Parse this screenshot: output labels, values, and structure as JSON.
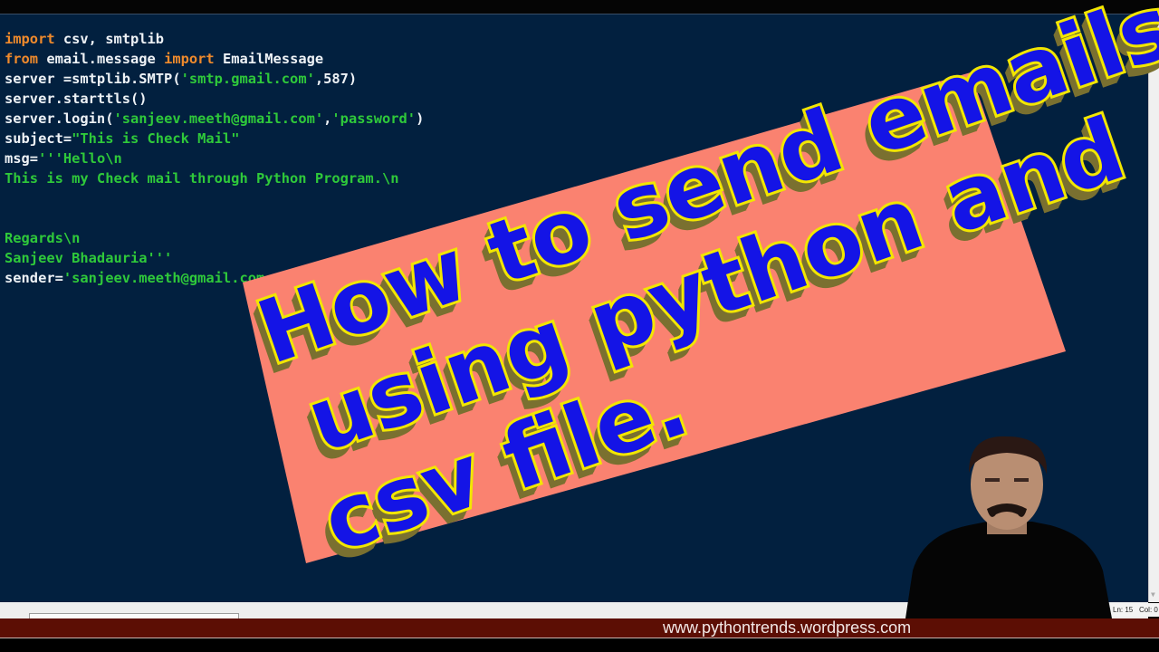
{
  "editor": {
    "code_lines": [
      [
        {
          "t": "import",
          "c": "kw"
        },
        {
          "t": " csv, smtplib",
          "c": ""
        }
      ],
      [
        {
          "t": "from",
          "c": "kw"
        },
        {
          "t": " email.message ",
          "c": ""
        },
        {
          "t": "import",
          "c": "kw"
        },
        {
          "t": " EmailMessage",
          "c": ""
        }
      ],
      [
        {
          "t": "server =smtplib.SMTP(",
          "c": ""
        },
        {
          "t": "'smtp.gmail.com'",
          "c": "str"
        },
        {
          "t": ",587)",
          "c": ""
        }
      ],
      [
        {
          "t": "server.starttls()",
          "c": ""
        }
      ],
      [
        {
          "t": "server.login(",
          "c": ""
        },
        {
          "t": "'sanjeev.meeth@gmail.com'",
          "c": "str"
        },
        {
          "t": ",",
          "c": ""
        },
        {
          "t": "'password'",
          "c": "str"
        },
        {
          "t": ")",
          "c": ""
        }
      ],
      [
        {
          "t": "subject=",
          "c": ""
        },
        {
          "t": "\"This is Check Mail\"",
          "c": "str"
        }
      ],
      [
        {
          "t": "msg=",
          "c": ""
        },
        {
          "t": "'''Hello\\n",
          "c": "str"
        }
      ],
      [
        {
          "t": "This is my Check mail through Python Program.\\n",
          "c": "str"
        }
      ],
      [],
      [],
      [
        {
          "t": "Regards\\n",
          "c": "str"
        }
      ],
      [
        {
          "t": "Sanjeev Bhadauria'''",
          "c": "str"
        }
      ],
      [
        {
          "t": "sender=",
          "c": ""
        },
        {
          "t": "'sanjeev.meeth@gmail.com",
          "c": "str"
        }
      ]
    ],
    "status_bar": {
      "line": "Ln: 15",
      "col": "Col: 0"
    }
  },
  "thumbnail_overlay": {
    "title_lines": [
      "How to send emails",
      "using python and",
      "csv file."
    ],
    "colors": {
      "panel": "#fa8270",
      "text": "#1414e6",
      "outline": "#f2e600",
      "shadow": "#7a7030"
    }
  },
  "webcam": {
    "description": "presenter webcam"
  },
  "banner": {
    "url": "www.pythontrends.wordpress.com"
  }
}
